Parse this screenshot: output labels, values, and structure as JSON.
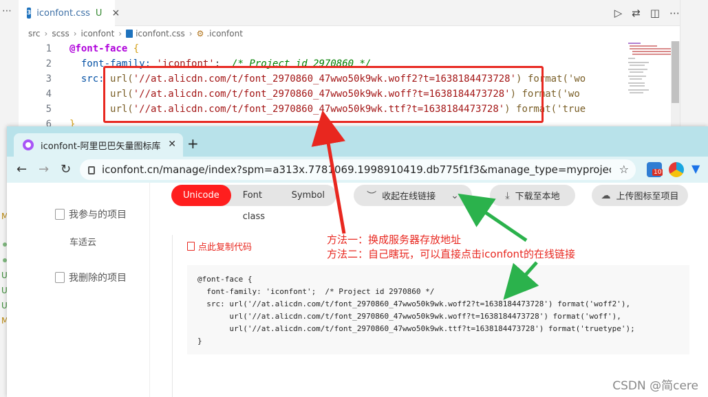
{
  "vscode": {
    "tab": {
      "icon": "css-file-icon",
      "filename": "iconfont.css",
      "status": "U",
      "close": "×"
    },
    "breadcrumb": [
      "src",
      "scss",
      "iconfont",
      "iconfont.css",
      ".iconfont"
    ],
    "code_lines": [
      {
        "n": "1"
      },
      {
        "n": "2"
      },
      {
        "n": "3"
      },
      {
        "n": "4"
      },
      {
        "n": "5"
      },
      {
        "n": "6"
      }
    ],
    "code": {
      "at_rule": "@font-face",
      "brace_open": " {",
      "prop_family": "font-family:",
      "family_val": "'iconfont'",
      "family_comment": "/* Project id 2970860 */",
      "prop_src": "src:",
      "url1": "'//at.alicdn.com/t/font_2970860_47wwo50k9wk.woff2?t=1638184473728'",
      "url2": "'//at.alicdn.com/t/font_2970860_47wwo50k9wk.woff?t=1638184473728'",
      "url3": "'//at.alicdn.com/t/font_2970860_47wwo50k9wk.ttf?t=1638184473728'",
      "fmt1": "format('wo",
      "fmt2": "format('wo",
      "fmt3": "format('true",
      "line6": "}"
    },
    "left_letters": [
      "M",
      "U",
      "U",
      "U",
      "M"
    ]
  },
  "browser": {
    "tab_title": "iconfont-阿里巴巴矢量图标库",
    "url": "iconfont.cn/manage/index?spm=a313x.7781069.1998910419.db775f1f3&manage_type=myprojects&project...",
    "extension_badge": "10",
    "sidebar": {
      "item1": "我参与的项目",
      "item2": "车适云",
      "item3": "我删除的项目"
    },
    "segments": {
      "unicode": "Unicode",
      "font_class": "Font class",
      "symbol": "Symbol"
    },
    "online_link": "收起在线链接",
    "download": "下载至本地",
    "upload": "上传图标至项目",
    "copy_code": "点此复制代码",
    "code_block": "@font-face {\n  font-family: 'iconfont';  /* Project id 2970860 */\n  src: url('//at.alicdn.com/t/font_2970860_47wwo50k9wk.woff2?t=1638184473728') format('woff2'),\n       url('//at.alicdn.com/t/font_2970860_47wwo50k9wk.woff?t=1638184473728') format('woff'),\n       url('//at.alicdn.com/t/font_2970860_47wwo50k9wk.ttf?t=1638184473728') format('truetype');\n}"
  },
  "annotations": {
    "method1": "方法一：换成服务器存放地址",
    "method2": "方法二：自己瞎玩，可以直接点击iconfont的在线链接",
    "arrow_colors": {
      "red": "#e8271f",
      "green": "#2bb24c"
    }
  },
  "watermark": "CSDN @简cere"
}
